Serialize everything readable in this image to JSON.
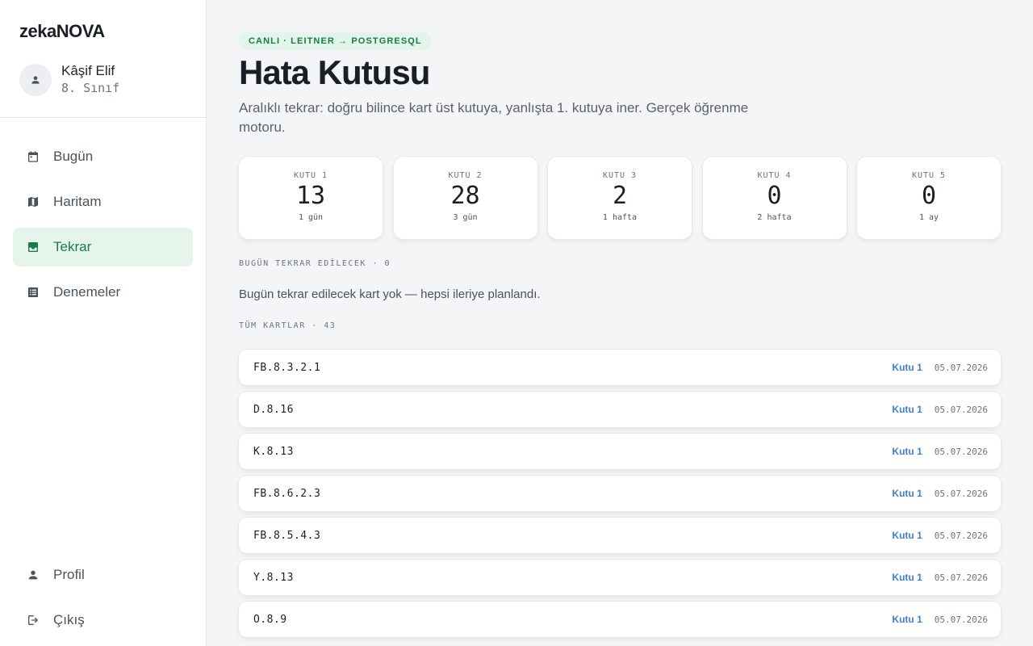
{
  "brand": "zekaNOVA",
  "user": {
    "name": "Kâşif Elif",
    "class": "8. Sınıf"
  },
  "nav": {
    "items": [
      {
        "label": "Bugün",
        "icon": "calendar-icon",
        "active": false
      },
      {
        "label": "Haritam",
        "icon": "map-icon",
        "active": false
      },
      {
        "label": "Tekrar",
        "icon": "inbox-icon",
        "active": true
      },
      {
        "label": "Denemeler",
        "icon": "checklist-icon",
        "active": false
      }
    ],
    "bottom": [
      {
        "label": "Profil",
        "icon": "person-icon"
      },
      {
        "label": "Çıkış",
        "icon": "logout-icon"
      }
    ]
  },
  "header": {
    "pill": "CANLI · LEITNER → POSTGRESQL",
    "title": "Hata Kutusu",
    "subtitle": "Aralıklı tekrar: doğru bilince kart üst kutuya, yanlışta 1. kutuya iner. Gerçek öğrenme motoru."
  },
  "boxes": [
    {
      "label": "KUTU 1",
      "count": "13",
      "interval": "1 gün"
    },
    {
      "label": "KUTU 2",
      "count": "28",
      "interval": "3 gün"
    },
    {
      "label": "KUTU 3",
      "count": "2",
      "interval": "1 hafta"
    },
    {
      "label": "KUTU 4",
      "count": "0",
      "interval": "2 hafta"
    },
    {
      "label": "KUTU 5",
      "count": "0",
      "interval": "1 ay"
    }
  ],
  "today": {
    "label": "BUGÜN TEKRAR EDİLECEK · 0",
    "empty_message": "Bugün tekrar edilecek kart yok — hepsi ileriye planlandı."
  },
  "all_cards": {
    "label": "TÜM KARTLAR · 43",
    "items": [
      {
        "code": "FB.8.3.2.1",
        "box": "Kutu 1",
        "date": "05.07.2026"
      },
      {
        "code": "D.8.16",
        "box": "Kutu 1",
        "date": "05.07.2026"
      },
      {
        "code": "K.8.13",
        "box": "Kutu 1",
        "date": "05.07.2026"
      },
      {
        "code": "FB.8.6.2.3",
        "box": "Kutu 1",
        "date": "05.07.2026"
      },
      {
        "code": "FB.8.5.4.3",
        "box": "Kutu 1",
        "date": "05.07.2026"
      },
      {
        "code": "Y.8.13",
        "box": "Kutu 1",
        "date": "05.07.2026"
      },
      {
        "code": "O.8.9",
        "box": "Kutu 1",
        "date": "05.07.2026"
      }
    ]
  },
  "colors": {
    "accent": "#1b7a49",
    "accent_bg": "#e6f5ec",
    "box_link": "#3f7fd1"
  }
}
